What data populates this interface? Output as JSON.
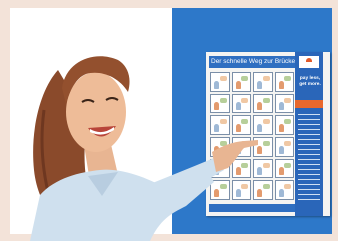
{
  "photo": {
    "description_icon": "woman-pointing-at-poster",
    "colors": {
      "background": "#f3e3d9",
      "blue_wall": "#2d78c9",
      "poster_blue": "#2f6fc1",
      "accent_orange": "#e8682c"
    }
  },
  "poster": {
    "title": "Der schnelle Weg zur Brücke",
    "tagline_line1": "pay less,",
    "tagline_line2": "get more."
  }
}
